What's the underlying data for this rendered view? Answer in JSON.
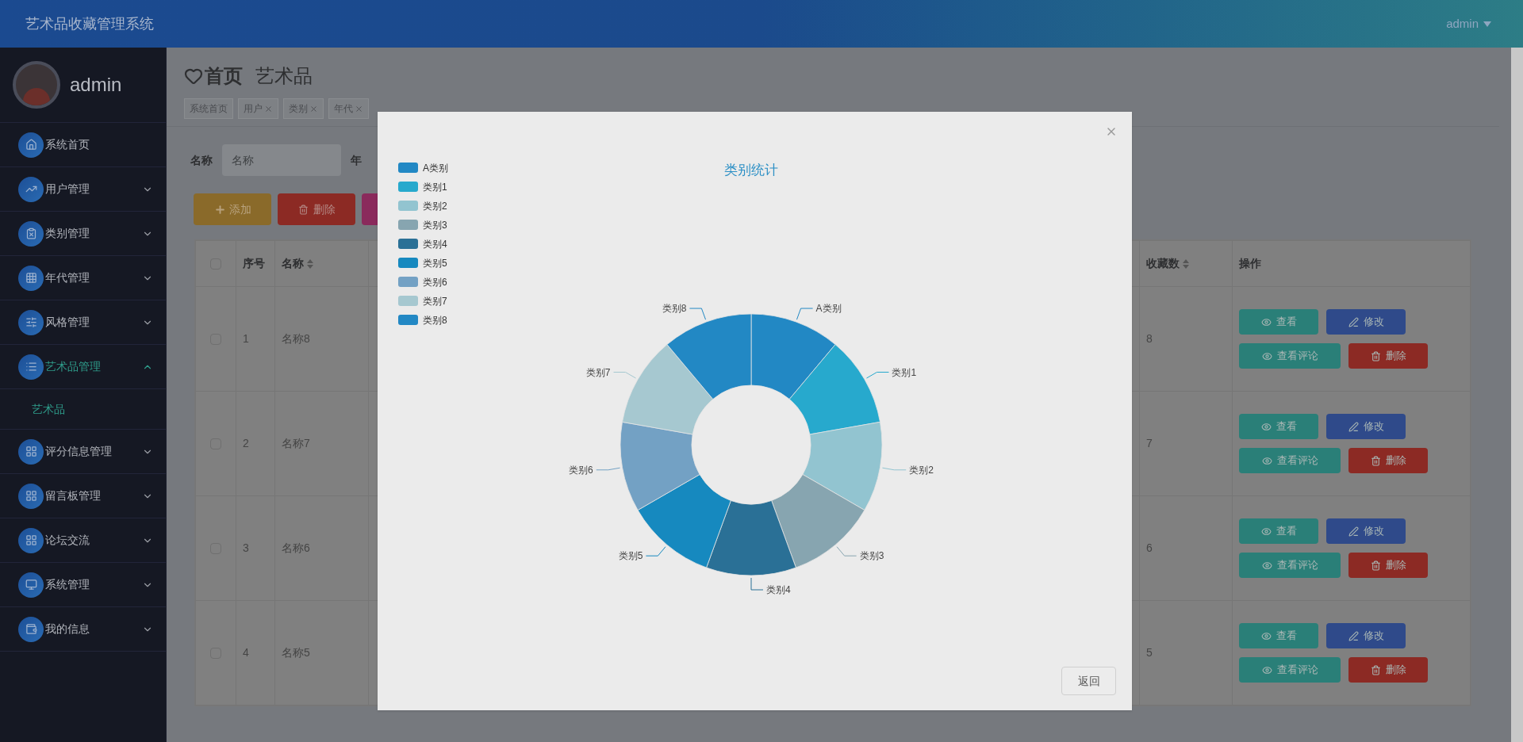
{
  "header": {
    "title": "艺术品收藏管理系统",
    "user": "admin"
  },
  "sidebar": {
    "user": "admin",
    "items": [
      {
        "label": "系统首页",
        "kind": "link",
        "selected": false
      },
      {
        "label": "用户管理",
        "kind": "group",
        "selected": false,
        "expanded": false
      },
      {
        "label": "类别管理",
        "kind": "group",
        "selected": false,
        "expanded": false
      },
      {
        "label": "年代管理",
        "kind": "group",
        "selected": false,
        "expanded": false
      },
      {
        "label": "风格管理",
        "kind": "group",
        "selected": false,
        "expanded": false
      },
      {
        "label": "艺术品管理",
        "kind": "group",
        "selected": true,
        "expanded": true,
        "children": [
          {
            "label": "艺术品",
            "selected": true
          }
        ]
      },
      {
        "label": "评分信息管理",
        "kind": "group",
        "selected": false,
        "expanded": false
      },
      {
        "label": "留言板管理",
        "kind": "group",
        "selected": false,
        "expanded": false
      },
      {
        "label": "论坛交流",
        "kind": "group",
        "selected": false,
        "expanded": false
      },
      {
        "label": "系统管理",
        "kind": "group",
        "selected": false,
        "expanded": false
      },
      {
        "label": "我的信息",
        "kind": "group",
        "selected": false,
        "expanded": false
      }
    ]
  },
  "breadcrumb": [
    "首页",
    "艺术品"
  ],
  "tags": [
    {
      "label": "系统首页",
      "closable": false,
      "selected": false
    },
    {
      "label": "用户",
      "closable": true,
      "selected": false
    },
    {
      "label": "类别",
      "closable": true,
      "selected": false
    },
    {
      "label": "年代",
      "closable": true,
      "selected": false
    }
  ],
  "search": {
    "label": "名称",
    "placeholder": "名称",
    "next_label": "年"
  },
  "toolbar": [
    {
      "kind": "add",
      "label": "添加"
    },
    {
      "kind": "delete",
      "label": "删除"
    },
    {
      "kind": "stats"
    }
  ],
  "table": {
    "all_checked": false,
    "columns": [
      {
        "label": "序号",
        "sortable": false
      },
      {
        "label": "名称",
        "sortable": true
      },
      {
        "label": "收藏数",
        "sortable": true
      },
      {
        "label": "操作",
        "sortable": false
      }
    ],
    "rows": [
      {
        "checked": false,
        "index": "1",
        "name": "名称8",
        "favorites": "8",
        "actions": [
          {
            "kind": "view",
            "label": "查看"
          },
          {
            "kind": "edit",
            "label": "修改"
          },
          {
            "kind": "comments",
            "label": "查看评论"
          },
          {
            "kind": "delete",
            "label": "删除"
          }
        ]
      },
      {
        "checked": false,
        "index": "2",
        "name": "名称7",
        "favorites": "7",
        "actions": [
          {
            "kind": "view",
            "label": "查看"
          },
          {
            "kind": "edit",
            "label": "修改"
          },
          {
            "kind": "comments",
            "label": "查看评论"
          },
          {
            "kind": "delete",
            "label": "删除"
          }
        ]
      },
      {
        "checked": false,
        "index": "3",
        "name": "名称6",
        "favorites": "6",
        "actions": [
          {
            "kind": "view",
            "label": "查看"
          },
          {
            "kind": "edit",
            "label": "修改"
          },
          {
            "kind": "comments",
            "label": "查看评论"
          },
          {
            "kind": "delete",
            "label": "删除"
          }
        ]
      },
      {
        "checked": false,
        "index": "4",
        "name": "名称5",
        "favorites": "5",
        "actions": [
          {
            "kind": "view",
            "label": "查看"
          },
          {
            "kind": "edit",
            "label": "修改"
          },
          {
            "kind": "comments",
            "label": "查看评论"
          },
          {
            "kind": "delete",
            "label": "删除"
          }
        ]
      }
    ]
  },
  "modal": {
    "legend": [
      {
        "label": "A类别",
        "color": "#2288c4"
      },
      {
        "label": "类别1",
        "color": "#27a9cd"
      },
      {
        "label": "类别2",
        "color": "#92c4d0"
      },
      {
        "label": "类别3",
        "color": "#87a5b0"
      },
      {
        "label": "类别4",
        "color": "#2a7096"
      },
      {
        "label": "类别5",
        "color": "#1689bf"
      },
      {
        "label": "类别6",
        "color": "#73a1c4"
      },
      {
        "label": "类别7",
        "color": "#a6c8d0"
      },
      {
        "label": "类别8",
        "color": "#2288c4"
      }
    ],
    "chart_data": {
      "type": "donut",
      "title": "类别统计",
      "categories": [
        "A类别",
        "类别1",
        "类别2",
        "类别3",
        "类别4",
        "类别5",
        "类别6",
        "类别7",
        "类别8"
      ],
      "series": [
        {
          "values": [
            1,
            1,
            1,
            1,
            1,
            1,
            1,
            1,
            1
          ]
        }
      ]
    },
    "close_button": "返回"
  }
}
